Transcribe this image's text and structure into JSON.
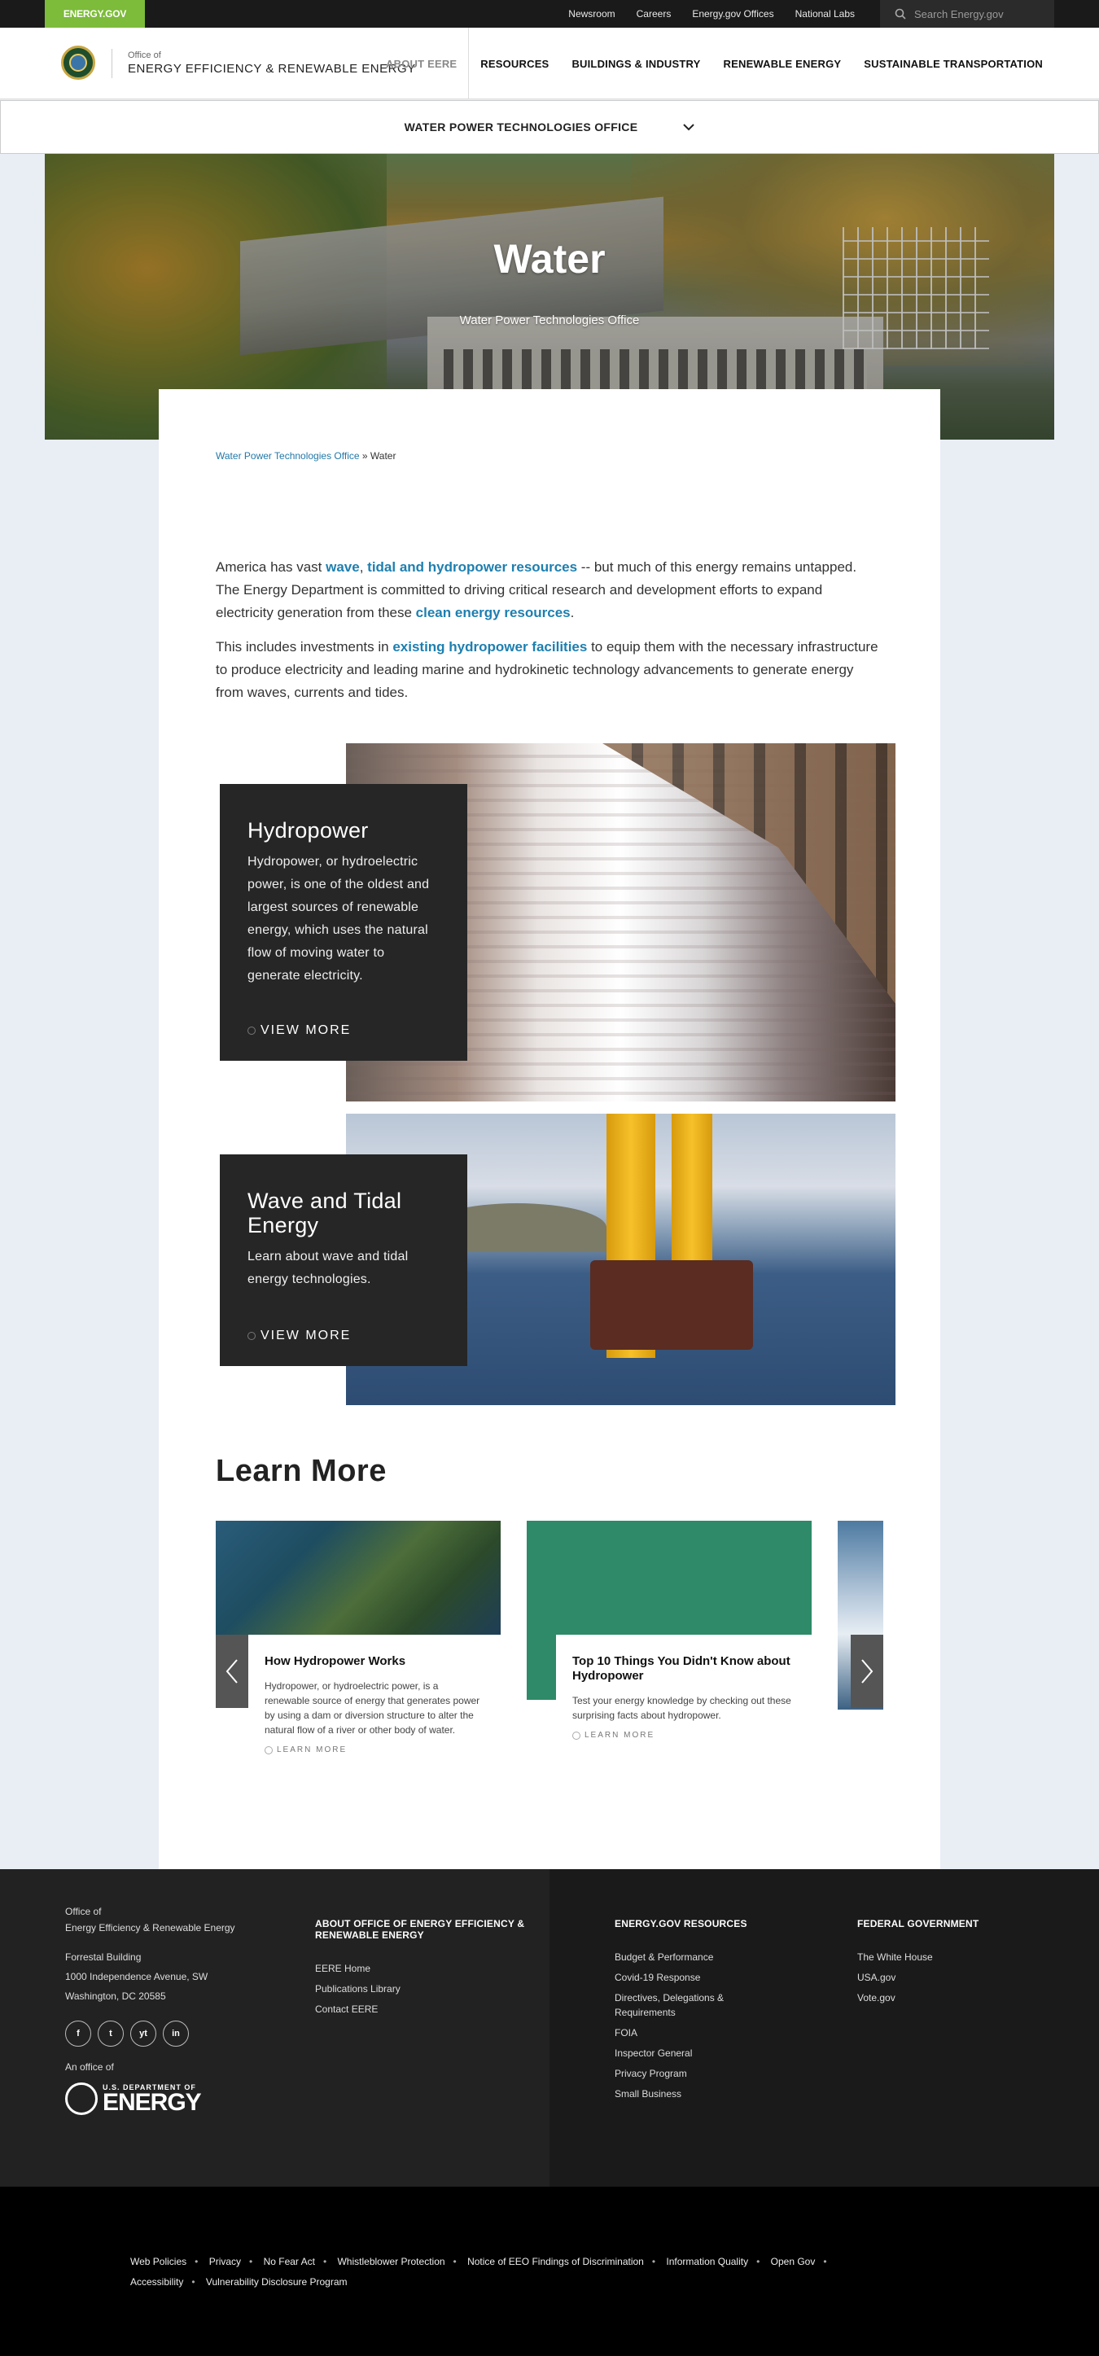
{
  "utility": {
    "brand": "ENERGY.GOV",
    "links": [
      "Newsroom",
      "Careers",
      "Energy.gov Offices",
      "National Labs"
    ],
    "search_placeholder": "Search Energy.gov"
  },
  "header": {
    "office_small": "Office of",
    "office_name": "ENERGY EFFICIENCY & RENEWABLE ENERGY",
    "nav": [
      "ABOUT EERE",
      "RESOURCES",
      "BUILDINGS & INDUSTRY",
      "RENEWABLE ENERGY",
      "SUSTAINABLE TRANSPORTATION"
    ]
  },
  "subnav": {
    "label": "WATER POWER TECHNOLOGIES OFFICE"
  },
  "hero": {
    "title": "Water",
    "subtitle": "Water Power Technologies Office"
  },
  "breadcrumb": {
    "parent": "Water Power Technologies Office",
    "separator": "»",
    "current": "Water"
  },
  "intro": {
    "p1_a": "America has vast ",
    "p1_link1": "wave",
    "p1_b": ", ",
    "p1_link2": "tidal and hydropower resources",
    "p1_c": " -- but much of this energy remains untapped. The Energy Department is committed to driving critical research and development efforts to expand electricity generation from these ",
    "p1_link3": "clean energy resources",
    "p1_d": ".",
    "p2_a": "This includes investments in ",
    "p2_link": "existing hydropower facilities",
    "p2_b": " to equip them with the necessary infrastructure to produce electricity and leading marine and hydrokinetic technology advancements to generate energy from waves, currents and tides."
  },
  "features": [
    {
      "title": "Hydropower",
      "text": "Hydropower, or hydroelectric power, is one of the oldest and largest sources of renewable energy, which uses the natural flow of moving water to generate electricity.",
      "cta": "VIEW MORE"
    },
    {
      "title": "Wave and Tidal Energy",
      "text": "Learn about wave and tidal energy technologies.",
      "cta": "VIEW MORE"
    }
  ],
  "learn_more": {
    "title": "Learn More",
    "cards": [
      {
        "title": "How Hydropower Works",
        "text": "Hydropower, or hydroelectric power, is a renewable source of energy that generates power by using a dam or diversion structure to alter the natural flow of a river or other body of water.",
        "cta": "LEARN MORE"
      },
      {
        "title": "Top 10 Things You Didn't Know about Hydropower",
        "text": "Test your energy knowledge by checking out these surprising facts about hydropower.",
        "cta": "LEARN MORE"
      }
    ]
  },
  "footer": {
    "office_small": "Office of",
    "office_name": "Energy Efficiency & Renewable Energy",
    "addr1": "Forrestal Building",
    "addr2": "1000 Independence Avenue, SW",
    "addr3": "Washington, DC 20585",
    "social": [
      "f",
      "t",
      "yt",
      "in"
    ],
    "an_office_of": "An office of",
    "doe_small": "U.S. DEPARTMENT OF",
    "doe_big": "ENERGY",
    "col2_title": "ABOUT OFFICE OF ENERGY EFFICIENCY & RENEWABLE ENERGY",
    "col2_links": [
      "EERE Home",
      "Publications Library",
      "Contact EERE"
    ],
    "col3_title": "ENERGY.GOV RESOURCES",
    "col3_links": [
      "Budget & Performance",
      "Covid-19 Response",
      "Directives, Delegations & Requirements",
      "FOIA",
      "Inspector General",
      "Privacy Program",
      "Small Business"
    ],
    "col4_title": "FEDERAL GOVERNMENT",
    "col4_links": [
      "The White House",
      "USA.gov",
      "Vote.gov"
    ]
  },
  "bottom_links": [
    "Web Policies",
    "Privacy",
    "No Fear Act",
    "Whistleblower Protection",
    "Notice of EEO Findings of Discrimination",
    "Information Quality",
    "Open Gov",
    "Accessibility",
    "Vulnerability Disclosure Program"
  ]
}
